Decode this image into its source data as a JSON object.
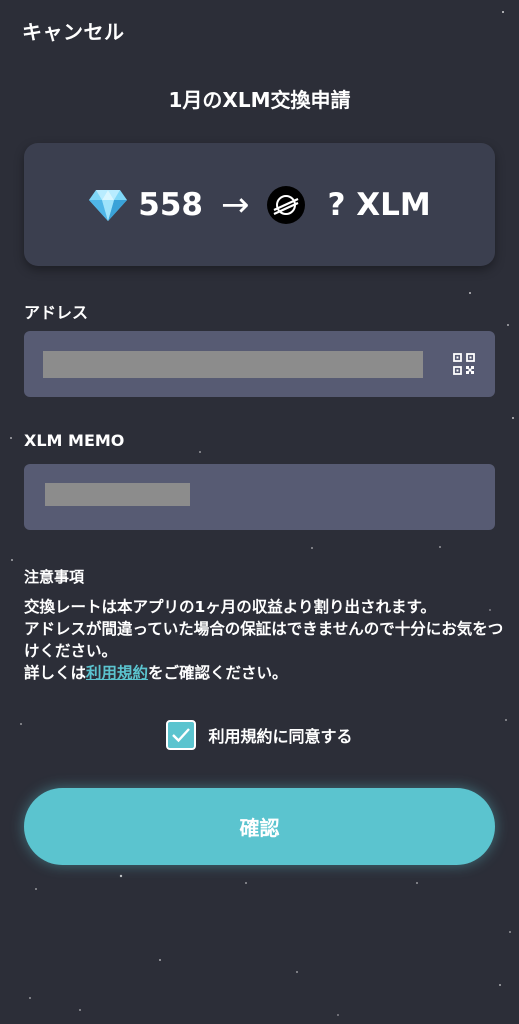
{
  "header": {
    "cancel_label": "キャンセル",
    "title": "1月のXLM交換申請"
  },
  "exchange": {
    "gem_amount": "558",
    "arrow": "→",
    "xlm_amount": "? XLM",
    "gem_icon": "diamond-icon",
    "xlm_icon": "stellar-logo-icon"
  },
  "address": {
    "label": "アドレス",
    "qr_icon": "qr-code-icon"
  },
  "memo": {
    "label": "XLM MEMO"
  },
  "notes": {
    "title": "注意事項",
    "line1": "交換レートは本アプリの1ヶ月の収益より割り出されます。",
    "line2": "アドレスが間違っていた場合の保証はできませんので十分にお気をつけください。",
    "line3_prefix": "詳しくは",
    "terms_link": "利用規約",
    "line3_suffix": "をご確認ください。"
  },
  "agree": {
    "label": "利用規約に同意する",
    "checked": true
  },
  "confirm_label": "確認",
  "colors": {
    "background": "#2c2e38",
    "card": "#3b3f4f",
    "input": "#575b73",
    "accent": "#5bc4cf"
  }
}
